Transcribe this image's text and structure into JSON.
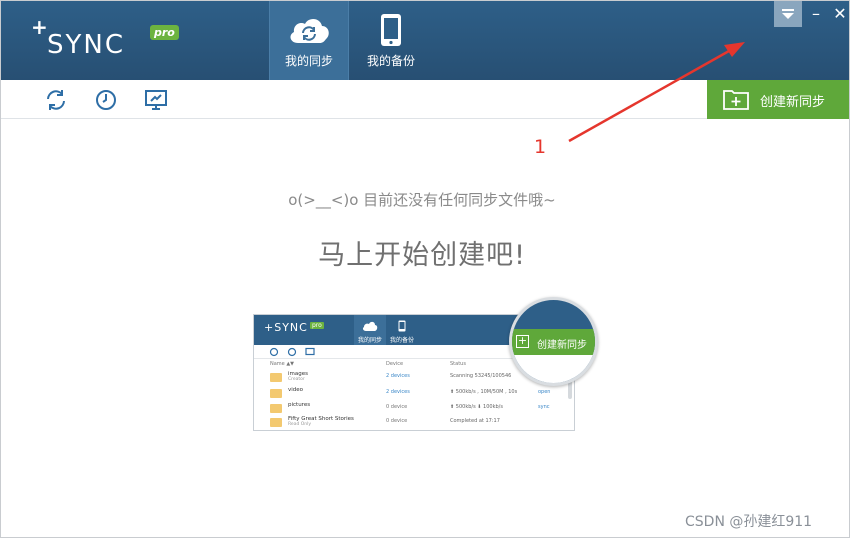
{
  "app": {
    "logo_plus": "+",
    "logo_word": "SYNC",
    "logo_badge": "pro",
    "accent_color": "#2e5f88",
    "green_color": "#5fa83a"
  },
  "header": {
    "tabs": [
      {
        "label": "我的同步",
        "icon": "cloud-sync-icon",
        "active": true
      },
      {
        "label": "我的备份",
        "icon": "phone-icon",
        "active": false
      }
    ],
    "window_controls": {
      "menu": "menu-dropdown-icon",
      "minimize": "–",
      "close": "✕"
    }
  },
  "toolbar": {
    "icons": [
      "refresh-icon",
      "history-clock-icon",
      "monitor-icon"
    ],
    "create_label": "创建新同步"
  },
  "empty_state": {
    "line1": "o(>__<)o   目前还没有任何同步文件哦~",
    "line2": "马上开始创建吧!"
  },
  "illustration": {
    "logo_word": "+SYNC",
    "logo_badge": "pro",
    "tabs": [
      "我的同步",
      "我的备份"
    ],
    "columns": [
      "Name ▲▼",
      "Device",
      "Status"
    ],
    "rows": [
      {
        "name": "images",
        "sub": "Creator",
        "device": "2 devices",
        "status": "Scanning  53245/100546",
        "action": ""
      },
      {
        "name": "video",
        "sub": "",
        "device": "2 devices",
        "status": "⬆ 500kb/s , 10M/50M , 10s",
        "action": "open"
      },
      {
        "name": "pictures",
        "sub": "",
        "device": "0 device",
        "status": "⬆ 500kb/s   ⬇ 100kb/s",
        "action": "sync"
      },
      {
        "name": "Fifty Great Short Stories",
        "sub": "Read Only",
        "device": "0 device",
        "status": "Completed at 17:17",
        "action": ""
      }
    ],
    "magnifier_label": "创建新同步"
  },
  "annotation": {
    "number": "1",
    "color": "#e5362d"
  },
  "watermark": "CSDN @孙建红911"
}
